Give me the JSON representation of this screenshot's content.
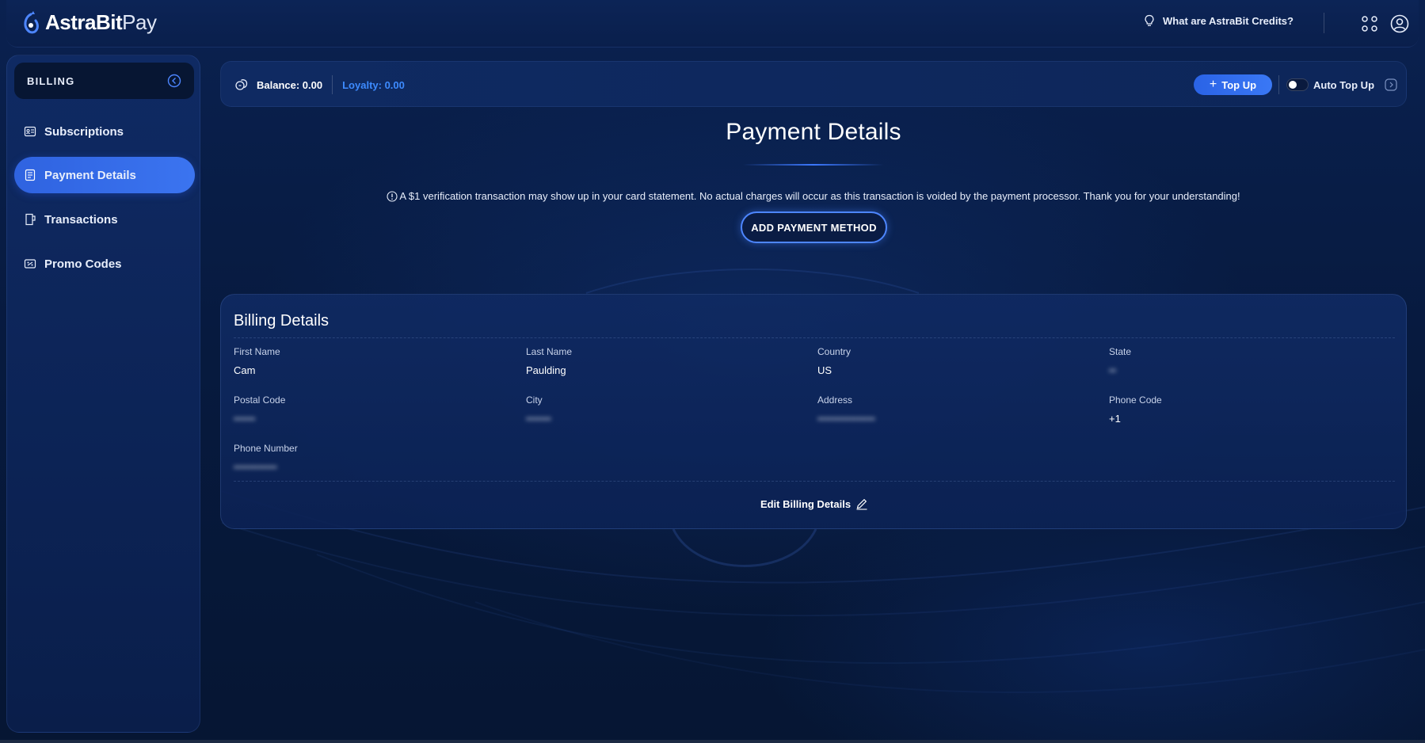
{
  "app": {
    "brand_main": "AstraBit",
    "brand_suffix": "Pay"
  },
  "topbar": {
    "credits_link": "What are AstraBit Credits?",
    "apps_icon": "grid-dots-icon",
    "account_icon": "user-circle-icon"
  },
  "sidebar": {
    "title": "BILLING",
    "items": [
      {
        "label": "Subscriptions",
        "icon": "subscriptions-icon",
        "active": false
      },
      {
        "label": "Payment Details",
        "icon": "document-icon",
        "active": true
      },
      {
        "label": "Transactions",
        "icon": "receipt-icon",
        "active": false
      },
      {
        "label": "Promo Codes",
        "icon": "ticket-icon",
        "active": false
      }
    ]
  },
  "balance_bar": {
    "balance": "Balance: 0.00",
    "loyalty": "Loyalty: 0.00",
    "topup_label": "Top Up",
    "auto_topup_label": "Auto Top Up",
    "auto_topup_enabled": false
  },
  "main": {
    "title": "Payment Details",
    "notice": "A $1 verification transaction may show up in your card statement. No actual charges will occur as this transaction is voided by the payment processor. Thank you for your understanding!",
    "add_payment_label": "ADD PAYMENT METHOD"
  },
  "billing": {
    "title": "Billing Details",
    "fields": {
      "first_name": {
        "label": "First Name",
        "value": "Cam"
      },
      "last_name": {
        "label": "Last Name",
        "value": "Paulding"
      },
      "country": {
        "label": "Country",
        "value": "US"
      },
      "state": {
        "label": "State",
        "value": "••"
      },
      "postal_code": {
        "label": "Postal Code",
        "value": "••••••"
      },
      "city": {
        "label": "City",
        "value": "•••••••"
      },
      "address": {
        "label": "Address",
        "value": "••••••••••••••••"
      },
      "phone_code": {
        "label": "Phone Code",
        "value": "+1"
      },
      "phone_number": {
        "label": "Phone Number",
        "value": "••••••••••••"
      }
    },
    "edit_label": "Edit Billing Details"
  },
  "colors": {
    "background": "#061633",
    "accent": "#3b74f0",
    "loyalty": "#3d8bff",
    "panel": "#0f2a63"
  }
}
